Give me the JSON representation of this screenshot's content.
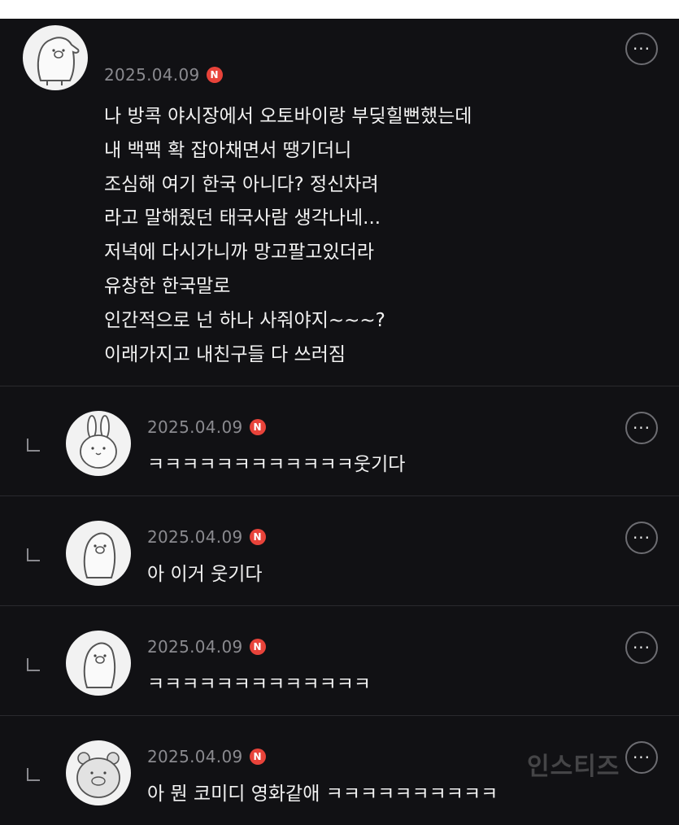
{
  "comments": [
    {
      "date": "2025.04.09",
      "badge": "N",
      "lines": [
        "나 방콕 야시장에서 오토바이랑 부딪힐뻔했는데",
        "내 백팩 확 잡아채면서 땡기더니",
        "조심해 여기 한국 아니다? 정신차려",
        "라고 말해줬던 태국사람 생각나네...",
        "저녁에 다시가니까 망고팔고있더라",
        "유창한 한국말로",
        "인간적으로 넌 하나 사줘야지~~~?",
        "이래가지고 내친구들 다 쓰러짐"
      ],
      "more_label": "···",
      "avatar_icon": "penguin-icon"
    }
  ],
  "replies": [
    {
      "date": "2025.04.09",
      "badge": "N",
      "text": "ㅋㅋㅋㅋㅋㅋㅋㅋㅋㅋㅋㅋ웃기다",
      "more_label": "···",
      "avatar_icon": "rabbit-icon"
    },
    {
      "date": "2025.04.09",
      "badge": "N",
      "text": "아 이거 웃기다",
      "more_label": "···",
      "avatar_icon": "penguin-icon"
    },
    {
      "date": "2025.04.09",
      "badge": "N",
      "text": "ㅋㅋㅋㅋㅋㅋㅋㅋㅋㅋㅋㅋㅋ",
      "more_label": "···",
      "avatar_icon": "penguin-icon"
    },
    {
      "date": "2025.04.09",
      "badge": "N",
      "text": "아 뭔 코미디 영화같애 ㅋㅋㅋㅋㅋㅋㅋㅋㅋㅋ",
      "more_label": "···",
      "avatar_icon": "bear-icon"
    }
  ],
  "watermark": "인스티즈",
  "colors": {
    "background": "#111114",
    "divider": "#2a2a2e",
    "badge": "#e8433a",
    "date_text": "#8a8a8f",
    "body_text": "#f2f2f2"
  }
}
